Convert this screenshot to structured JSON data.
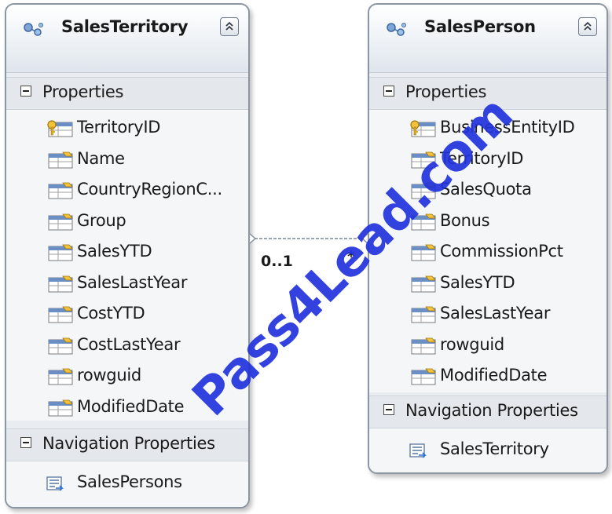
{
  "entities": {
    "left": {
      "title": "SalesTerritory",
      "properties_label": "Properties",
      "properties": [
        "TerritoryID",
        "Name",
        "CountryRegionC...",
        "Group",
        "SalesYTD",
        "SalesLastYear",
        "CostYTD",
        "CostLastYear",
        "rowguid",
        "ModifiedDate"
      ],
      "navigation_label": "Navigation Properties",
      "navigation": [
        "SalesPersons"
      ]
    },
    "right": {
      "title": "SalesPerson",
      "properties_label": "Properties",
      "properties": [
        "BusinessEntityID",
        "TerritoryID",
        "SalesQuota",
        "Bonus",
        "CommissionPct",
        "SalesYTD",
        "SalesLastYear",
        "rowguid",
        "ModifiedDate"
      ],
      "navigation_label": "Navigation Properties",
      "navigation": [
        "SalesTerritory"
      ]
    }
  },
  "association": {
    "left_multiplicity": "0..1",
    "right_multiplicity": "*"
  },
  "watermark": "Pass4Lead.com",
  "icons": {
    "entity": "entity-type-icon",
    "key_property": "key-property-icon",
    "property": "scalar-property-icon",
    "navigation": "navigation-property-icon",
    "collapse": "collapse-chevron-icon"
  }
}
